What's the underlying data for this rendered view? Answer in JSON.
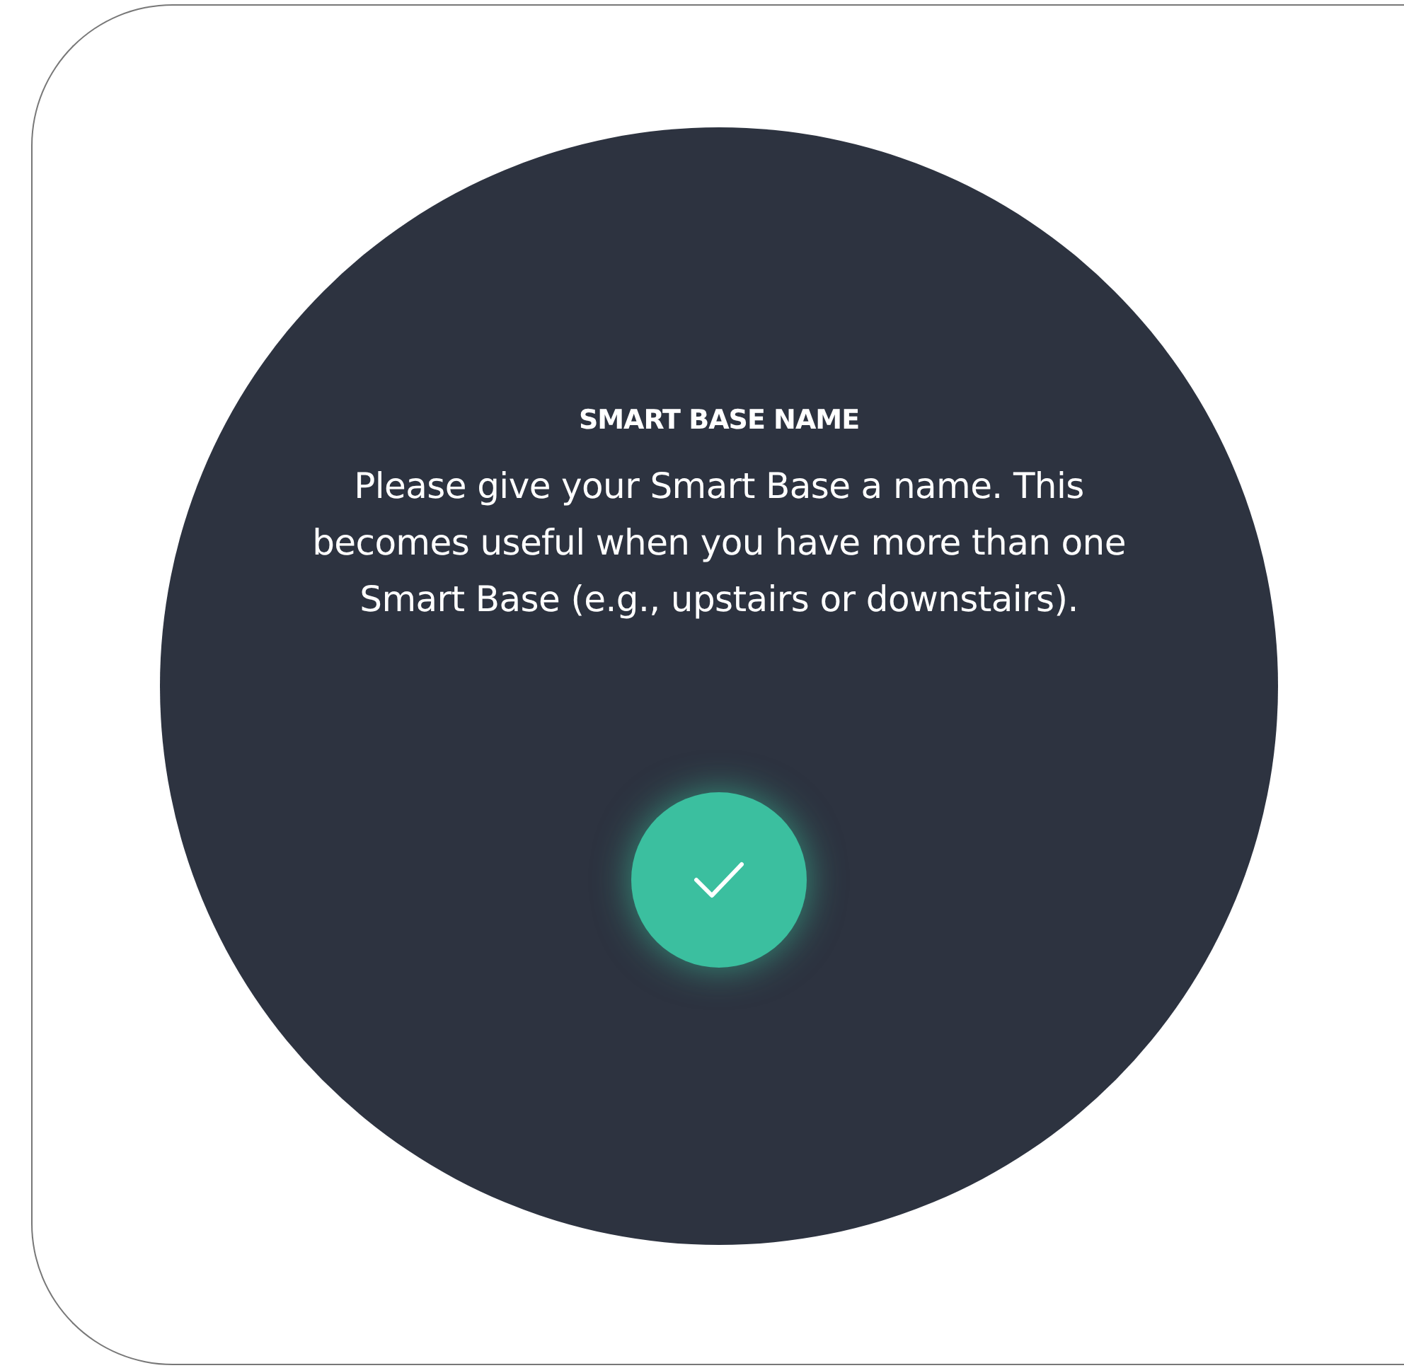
{
  "dialog": {
    "title": "SMART BASE NAME",
    "message": "Please give your Smart Base a name. This becomes useful when you have more than one Smart Base (e.g., upstairs or downstairs)."
  }
}
